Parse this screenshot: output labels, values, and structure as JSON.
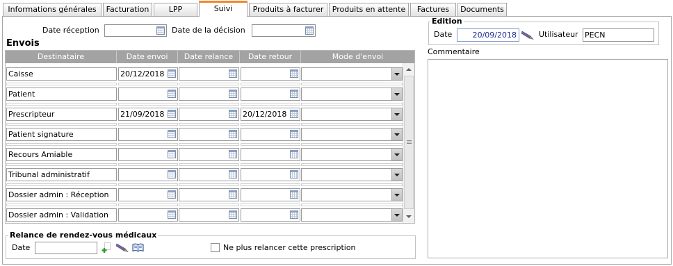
{
  "tabs": [
    {
      "label": "Informations générales",
      "active": false
    },
    {
      "label": "Facturation",
      "active": false
    },
    {
      "label": "LPP",
      "active": false
    },
    {
      "label": "Suivi",
      "active": true
    },
    {
      "label": "Produits à facturer",
      "active": false
    },
    {
      "label": "Produits en attente",
      "active": false
    },
    {
      "label": "Factures",
      "active": false
    },
    {
      "label": "Documents",
      "active": false
    }
  ],
  "dates": {
    "reception_label": "Date réception",
    "reception_value": "",
    "decision_label": "Date de la décision",
    "decision_value": ""
  },
  "envois": {
    "title": "Envois",
    "columns": [
      "Destinataire",
      "Date envoi",
      "Date relance",
      "Date retour",
      "Mode d'envoi"
    ],
    "rows": [
      {
        "destinataire": "Caisse",
        "date_envoi": "20/12/2018",
        "date_relance": "",
        "date_retour": "",
        "mode_envoi": ""
      },
      {
        "destinataire": "Patient",
        "date_envoi": "",
        "date_relance": "",
        "date_retour": "",
        "mode_envoi": ""
      },
      {
        "destinataire": "Prescripteur",
        "date_envoi": "21/09/2018",
        "date_relance": "",
        "date_retour": "20/12/2018",
        "mode_envoi": ""
      },
      {
        "destinataire": "Patient signature",
        "date_envoi": "",
        "date_relance": "",
        "date_retour": "",
        "mode_envoi": ""
      },
      {
        "destinataire": "Recours Amiable",
        "date_envoi": "",
        "date_relance": "",
        "date_retour": "",
        "mode_envoi": ""
      },
      {
        "destinataire": "Tribunal administratif",
        "date_envoi": "",
        "date_relance": "",
        "date_retour": "",
        "mode_envoi": ""
      },
      {
        "destinataire": "Dossier admin : Réception",
        "date_envoi": "",
        "date_relance": "",
        "date_retour": "",
        "mode_envoi": ""
      },
      {
        "destinataire": "Dossier admin : Validation",
        "date_envoi": "",
        "date_relance": "",
        "date_retour": "",
        "mode_envoi": ""
      }
    ]
  },
  "relance": {
    "legend": "Relance de rendez-vous médicaux",
    "date_label": "Date",
    "date_value": "",
    "stop_label": "Ne plus relancer cette prescription",
    "stop_checked": false
  },
  "edition": {
    "legend": "Edition",
    "date_label": "Date",
    "date_value": "20/09/2018",
    "user_label": "Utilisateur",
    "user_value": "PECN"
  },
  "commentaire": {
    "label": "Commentaire",
    "value": ""
  },
  "icons": {
    "date_picker": "calendar-icon",
    "dropdown": "chevron-down-icon",
    "add_relance": "add-icon",
    "signature": "quill-icon",
    "agenda": "book-icon"
  },
  "colors": {
    "active_tab_accent": "#f0892a",
    "table_header": "#a3a3a3",
    "edition_date_text": "#1c2b8a"
  }
}
